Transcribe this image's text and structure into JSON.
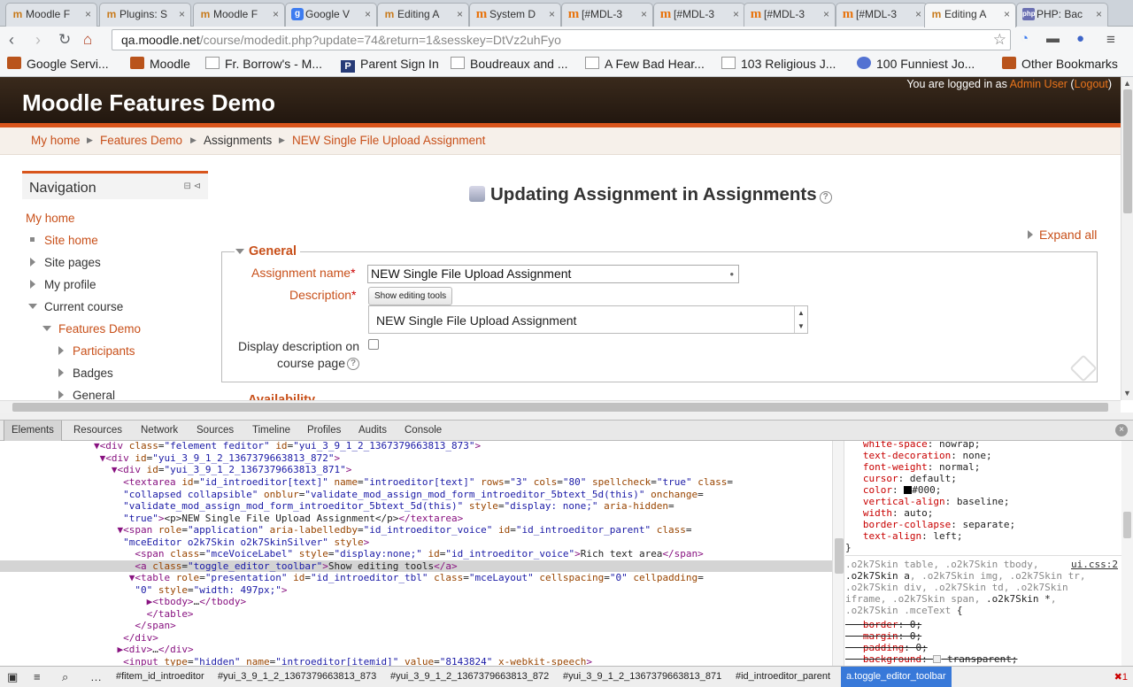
{
  "browser": {
    "tabs": [
      {
        "label": "Moodle F",
        "icon": "moodle-hat-icon"
      },
      {
        "label": "Plugins: S",
        "icon": "moodle-hat-icon"
      },
      {
        "label": "Moodle F",
        "icon": "moodle-hat-icon"
      },
      {
        "label": "Google V",
        "icon": "google-icon"
      },
      {
        "label": "Editing A",
        "icon": "moodle-hat-icon"
      },
      {
        "label": "System D",
        "icon": "moodle-m-icon"
      },
      {
        "label": "[#MDL-3",
        "icon": "moodle-m-icon"
      },
      {
        "label": "[#MDL-3",
        "icon": "moodle-m-icon"
      },
      {
        "label": "[#MDL-3",
        "icon": "moodle-m-icon"
      },
      {
        "label": "[#MDL-3",
        "icon": "moodle-m-icon"
      },
      {
        "label": "Editing A",
        "icon": "moodle-hat-icon",
        "active": true
      },
      {
        "label": "PHP: Bac",
        "icon": "php-icon"
      }
    ],
    "url_host": "qa.moodle.net",
    "url_path": "/course/modedit.php?update=74&return=1&sesskey=DtVz2uhFyo",
    "bookmarks": [
      "Google Servi...",
      "Moodle",
      "Fr. Borrow's - M...",
      "Parent Sign In",
      "Boudreaux and ...",
      "A Few Bad Hear...",
      "103 Religious J...",
      "100 Funniest Jo...",
      "Other Bookmarks"
    ]
  },
  "site": {
    "title": "Moodle Features Demo",
    "login_prefix": "You are logged in as ",
    "login_user": "Admin User",
    "logout_label": "Logout",
    "login_open": " (",
    "login_close": ")"
  },
  "breadcrumb": [
    "My home",
    "Features Demo",
    "Assignments",
    "NEW Single File Upload Assignment"
  ],
  "navigation": {
    "title": "Navigation",
    "items": [
      "My home",
      "Site home",
      "Site pages",
      "My profile",
      "Current course",
      "Features Demo",
      "Participants",
      "Badges",
      "General"
    ]
  },
  "main": {
    "heading": "Updating Assignment in Assignments",
    "expand_all": "Expand all",
    "section_general": "General",
    "assignment_name_label": "Assignment name",
    "assignment_name_value": "NEW Single File Upload Assignment",
    "description_label": "Description",
    "show_editing_tools": "Show editing tools",
    "description_value": "NEW Single File Upload Assignment",
    "display_desc_line1": "Display description on",
    "display_desc_line2": "course page",
    "next_section": "Availability",
    "required_mark": "*"
  },
  "devtools": {
    "tabs": [
      "Elements",
      "Resources",
      "Network",
      "Sources",
      "Timeline",
      "Profiles",
      "Audits",
      "Console"
    ],
    "bottom_crumbs": [
      "#fitem_id_introeditor",
      "#yui_3_9_1_2_1367379663813_873",
      "#yui_3_9_1_2_1367379663813_872",
      "#yui_3_9_1_2_1367379663813_871",
      "#id_introeditor_parent",
      "a.toggle_editor_toolbar"
    ],
    "styles_source": "ui.css:2",
    "error_count": "1"
  },
  "colors": {
    "accent": "#c8501a",
    "header_bg": "#2b2017",
    "orange_bar": "#d8551c",
    "devtools_selected": "#3879d9"
  }
}
